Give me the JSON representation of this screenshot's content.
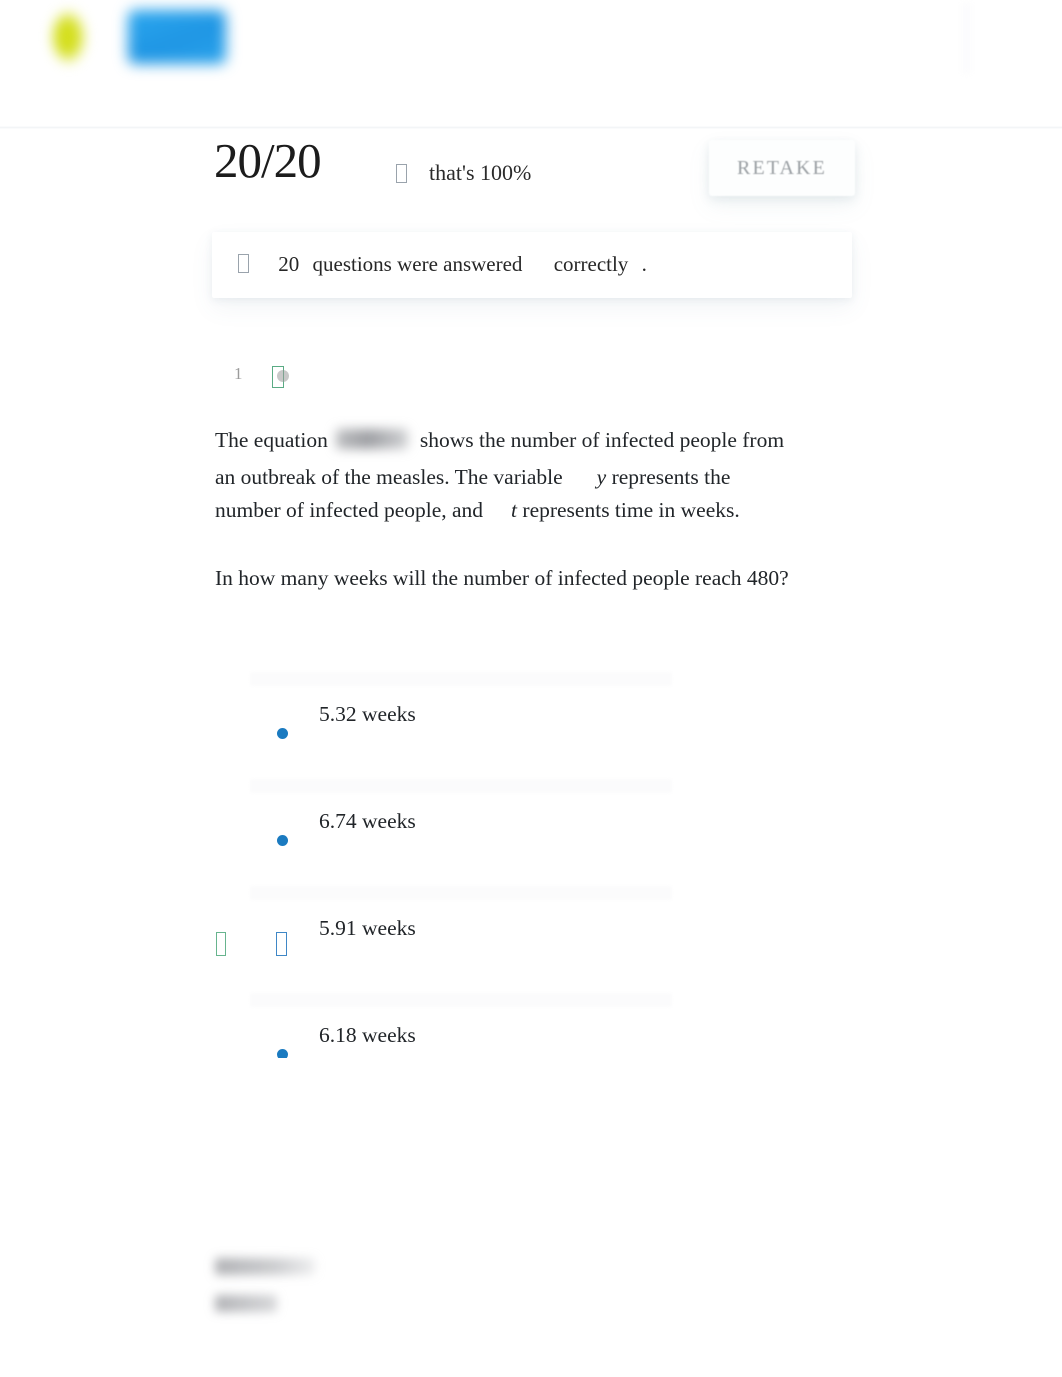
{
  "topbar": {
    "logo_mark": "leaf-logo",
    "logo_badge": "brand-badge"
  },
  "score_header": {
    "score": "20/20",
    "percent_text": "that's 100%",
    "percent_icon": "missing-glyph-box",
    "retake_label": "RETAKE"
  },
  "banner": {
    "icon": "missing-glyph-box",
    "count": "20",
    "text_mid": "questions were answered",
    "text_status": "correctly",
    "period": "."
  },
  "question": {
    "number": "1",
    "status_icon": "green-check-box",
    "body_part1": "The equation",
    "equation_redacted": "",
    "body_part2": "shows the number of infected people from",
    "body_line2_a": "an outbreak of the measles. The variable",
    "body_line2_var": "y",
    "body_line2_b": "represents the",
    "body_line3_a": "number of infected people, and",
    "body_line3_var": "t",
    "body_line3_b": "represents time in weeks.",
    "prompt": "In how many weeks will the number of infected people reach 480?"
  },
  "options": [
    {
      "label": "5.32 weeks",
      "marker": "radio-dot",
      "selected": false,
      "correct": false
    },
    {
      "label": "6.74 weeks",
      "marker": "radio-dot",
      "selected": false,
      "correct": false
    },
    {
      "label": "5.91 weeks",
      "marker": "missing-glyph-box",
      "selected": true,
      "correct": true
    },
    {
      "label": "6.18 weeks",
      "marker": "radio-dot",
      "selected": false,
      "correct": false
    }
  ],
  "colors": {
    "radio_blue": "#1a7ac0",
    "correct_green": "#67b48e",
    "selected_blue": "#3f87c6",
    "muted_grey": "#9a9fa3",
    "text": "#212529"
  }
}
